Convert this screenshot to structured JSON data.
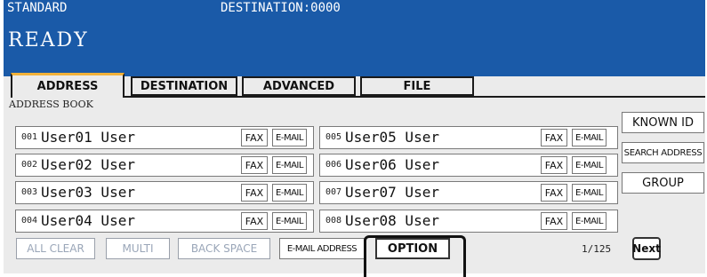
{
  "header": {
    "mode": "STANDARD",
    "destination": "DESTINATION:0000",
    "status": "READY"
  },
  "tabs": [
    "ADDRESS",
    "DESTINATION",
    "ADVANCED",
    "FILE"
  ],
  "section_label": "ADDRESS BOOK",
  "entries": [
    {
      "num": "001",
      "name": "User01 User",
      "fax": "FAX",
      "email": "E-MAIL"
    },
    {
      "num": "002",
      "name": "User02 User",
      "fax": "FAX",
      "email": "E-MAIL"
    },
    {
      "num": "003",
      "name": "User03 User",
      "fax": "FAX",
      "email": "E-MAIL"
    },
    {
      "num": "004",
      "name": "User04 User",
      "fax": "FAX",
      "email": "E-MAIL"
    },
    {
      "num": "005",
      "name": "User05 User",
      "fax": "FAX",
      "email": "E-MAIL"
    },
    {
      "num": "006",
      "name": "User06 User",
      "fax": "FAX",
      "email": "E-MAIL"
    },
    {
      "num": "007",
      "name": "User07 User",
      "fax": "FAX",
      "email": "E-MAIL"
    },
    {
      "num": "008",
      "name": "User08 User",
      "fax": "FAX",
      "email": "E-MAIL"
    }
  ],
  "side_buttons": {
    "known_id": "KNOWN ID",
    "search_address": "SEARCH ADDRESS",
    "group": "GROUP"
  },
  "bottom_buttons": {
    "all_clear": "ALL CLEAR",
    "multi": "MULTI",
    "back_space": "BACK SPACE",
    "email_address": "E-MAIL ADDRESS",
    "option": "OPTION"
  },
  "pager": {
    "page": "1/125",
    "next": "Next"
  },
  "colors": {
    "header_bg": "#1a5aa8",
    "active_tab_accent": "#f2b23a",
    "disabled_text": "#9aa6b8"
  }
}
